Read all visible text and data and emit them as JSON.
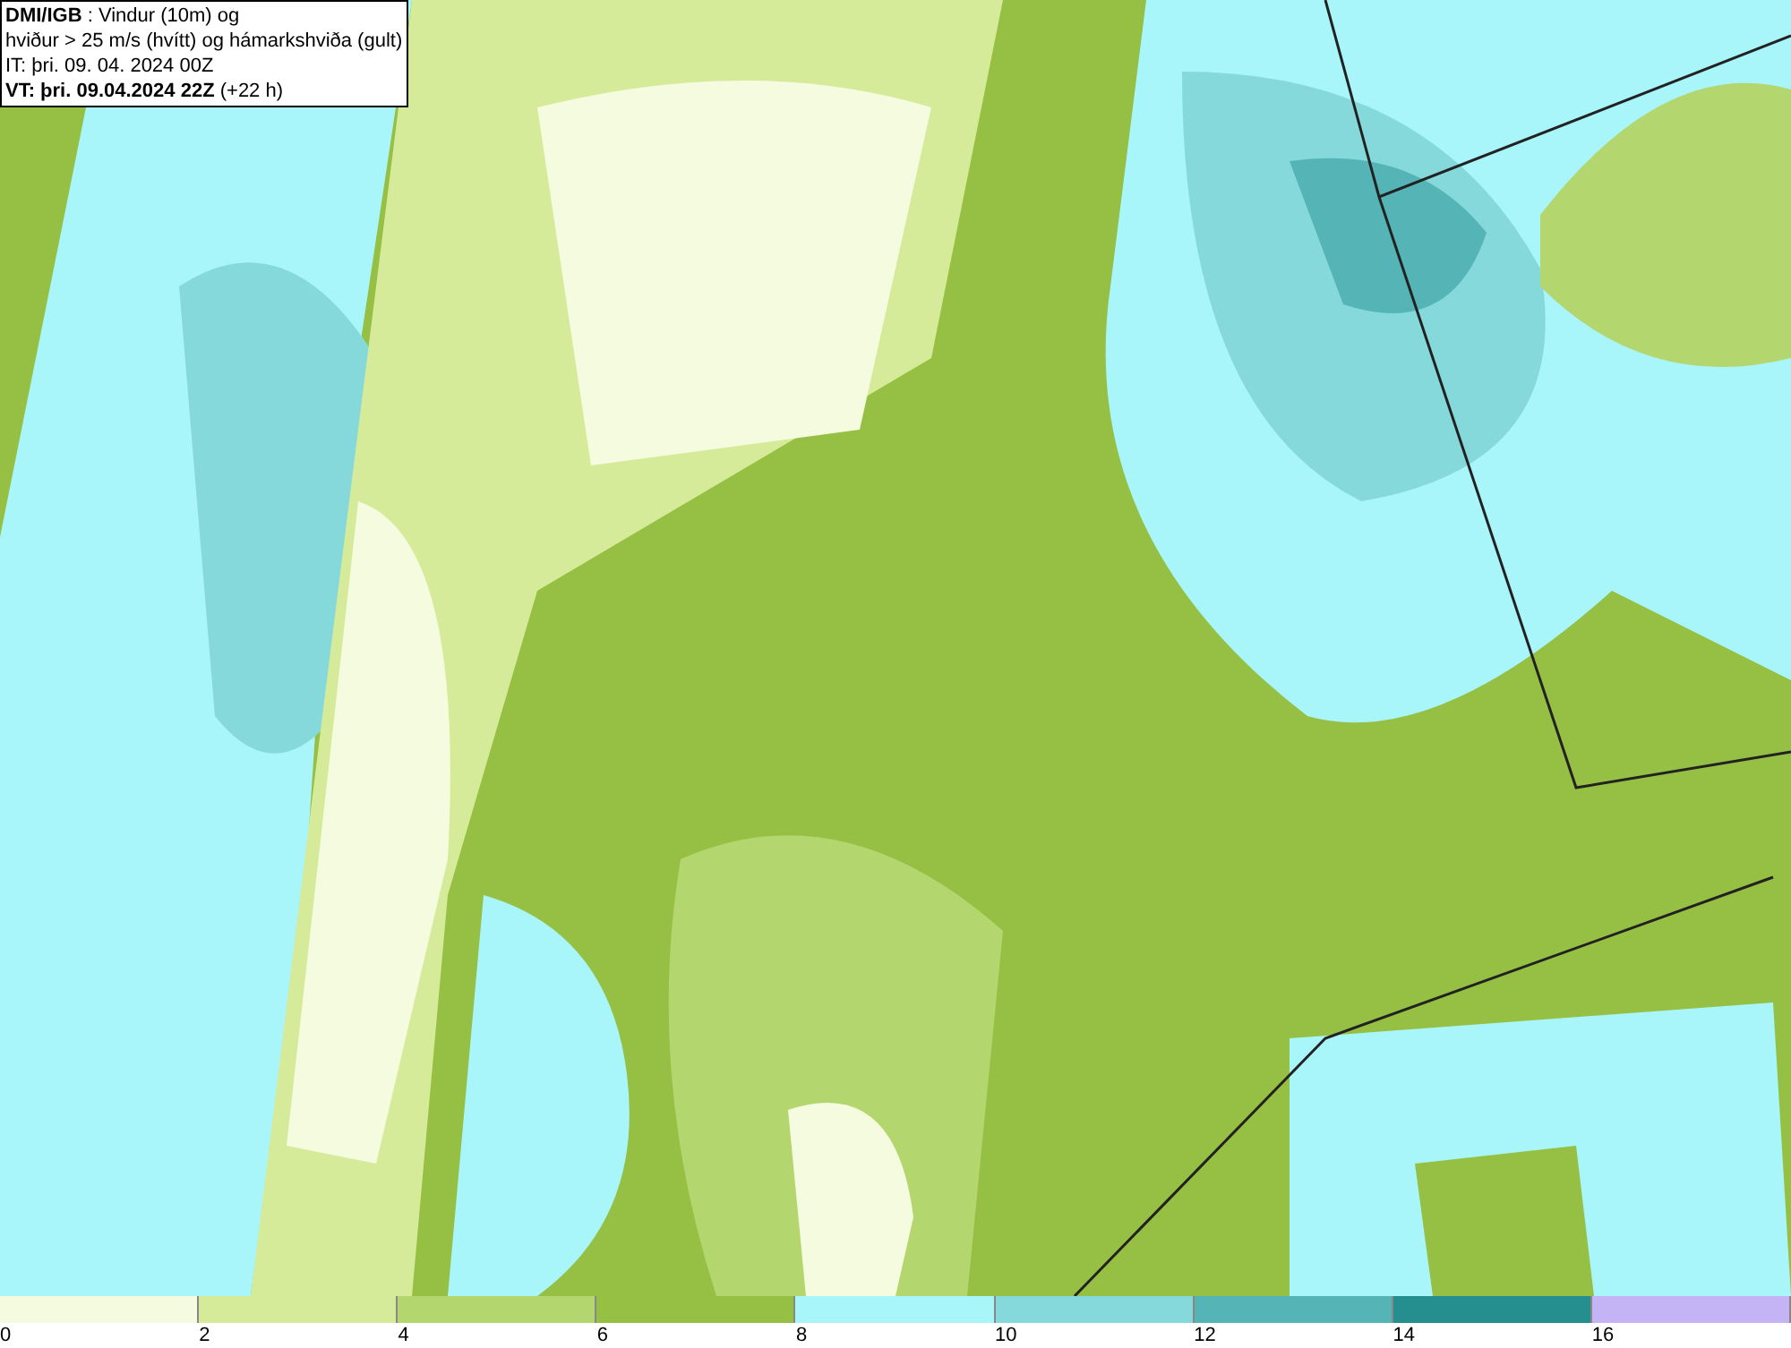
{
  "legend": {
    "lines": [
      "**DMI/IGB** : Vindur (10m) og",
      "hviður > 25 m/s (hvítt) og hámarkshviða (gult)",
      "IT: þri. 09. 04. 2024 00Z",
      "**VT: þri. 09.04.2024 22Z** (+22 h)"
    ]
  },
  "color_scale": {
    "segments": [
      {
        "color": "#f5fbdf",
        "label": "0"
      },
      {
        "color": "#d6eb9a",
        "label": "2"
      },
      {
        "color": "#b3d66e",
        "label": "4"
      },
      {
        "color": "#96c044",
        "label": "6"
      },
      {
        "color": "#a8f5fa",
        "label": "8"
      },
      {
        "color": "#86d9da",
        "label": "10"
      },
      {
        "color": "#55b4b5",
        "label": "12"
      },
      {
        "color": "#248f8e",
        "label": "14"
      },
      {
        "color": "#c4b3f5",
        "label": "16"
      }
    ]
  }
}
